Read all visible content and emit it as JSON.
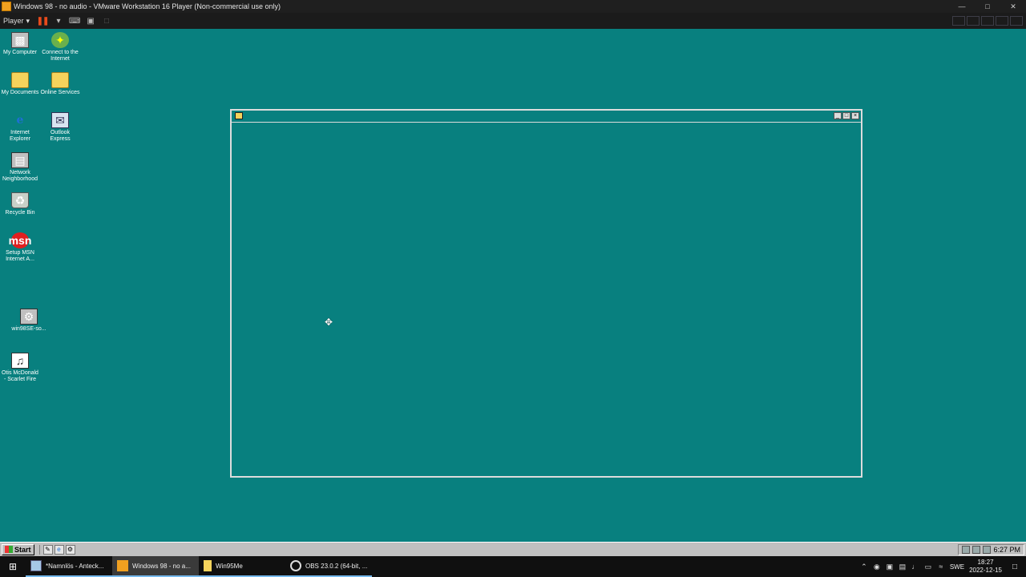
{
  "vm_window": {
    "title": "Windows 98 - no audio - VMware Workstation 16 Player (Non-commercial use only)",
    "controls": {
      "minimize": "—",
      "maximize": "□",
      "close": "✕"
    }
  },
  "vm_toolbar": {
    "player_menu": "Player"
  },
  "desktop": {
    "background_color": "#08807f",
    "icons": [
      {
        "label": "My Computer",
        "icon": "computer-icon"
      },
      {
        "label": "Connect to the Internet",
        "icon": "connect-icon"
      },
      {
        "label": "My Documents",
        "icon": "folder-icon"
      },
      {
        "label": "Online Services",
        "icon": "folder-icon"
      },
      {
        "label": "Internet Explorer",
        "icon": "ie-icon"
      },
      {
        "label": "Outlook Express",
        "icon": "outlook-icon"
      },
      {
        "label": "Network Neighborhood",
        "icon": "network-icon"
      },
      {
        "label": "Recycle Bin",
        "icon": "recycle-icon"
      },
      {
        "label": "Setup MSN Internet A...",
        "icon": "msn-icon"
      },
      {
        "label": "win98SE-so...",
        "icon": "setup-icon"
      },
      {
        "label": "Otis McDonald - Scarlet Fire",
        "icon": "document-icon"
      }
    ]
  },
  "guest_taskbar": {
    "start_label": "Start",
    "clock": "6:27 PM"
  },
  "host_taskbar": {
    "tasks": [
      {
        "label": "*Namnlös - Anteck...",
        "icon": "notepad-icon"
      },
      {
        "label": "Windows 98 - no a...",
        "icon": "vmware-icon"
      },
      {
        "label": "Win95Me",
        "icon": "folder-icon"
      },
      {
        "label": "OBS 23.0.2 (64-bit, ...",
        "icon": "obs-icon"
      }
    ],
    "language": "SWE",
    "time": "18:27",
    "date": "2022-12-15"
  }
}
